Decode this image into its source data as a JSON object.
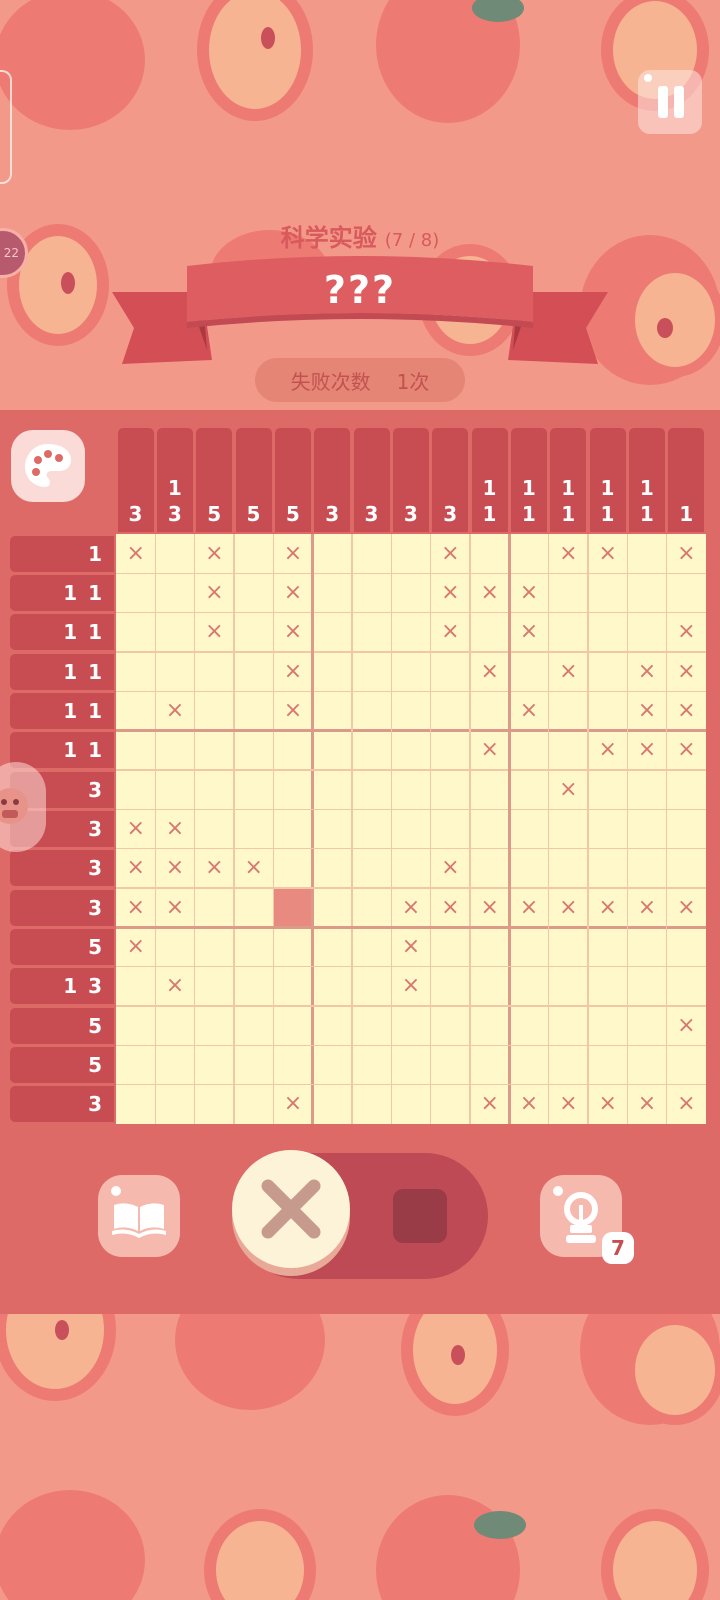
{
  "level": {
    "title": "科学实验",
    "progress": "(7 / 8)",
    "name": "???"
  },
  "failures": {
    "label": "失败次数",
    "value": "1次"
  },
  "hint_count": "7",
  "side_badge": "22",
  "colors": {
    "cell_bg": "#fef8cb",
    "filled": "#e98a80",
    "x_mark": "#d8776f",
    "clue_bg": "#c84d53",
    "panel": "#dd6a66",
    "background": "#f2998a"
  },
  "icons": {
    "pause": "pause-icon",
    "palette": "palette-icon",
    "book": "book-icon",
    "hint": "lightbulb-icon",
    "cross_mode": "x-icon",
    "fill_mode": "square-icon"
  },
  "puzzle": {
    "size": 15,
    "col_clues": [
      [
        "3"
      ],
      [
        "1",
        "3"
      ],
      [
        "5"
      ],
      [
        "5"
      ],
      [
        "5"
      ],
      [
        "3"
      ],
      [
        "3"
      ],
      [
        "3"
      ],
      [
        "3"
      ],
      [
        "1",
        "1"
      ],
      [
        "1",
        "1"
      ],
      [
        "1",
        "1"
      ],
      [
        "1",
        "1"
      ],
      [
        "1",
        "1"
      ],
      [
        "1"
      ]
    ],
    "row_clues": [
      "1",
      "1 1",
      "1 1",
      "1 1",
      "1 1",
      "1 1",
      "3",
      "3",
      "3",
      "3",
      "5",
      "1 3",
      "5",
      "5",
      "3"
    ],
    "cells": [
      "x.x.x...x..xx.x",
      "..x.x...xxx....",
      "..x.x...x.x...x",
      "....x....x.x.xx",
      ".x..x.....x..xx",
      ".........x..xxx",
      "...........x...",
      "xx.............",
      "xxxx....x......",
      "xx..#..xxxxxxxx",
      "x......x.......",
      ".x.....x.......",
      "..............x",
      "...............",
      "....x....xxxxxx"
    ]
  }
}
